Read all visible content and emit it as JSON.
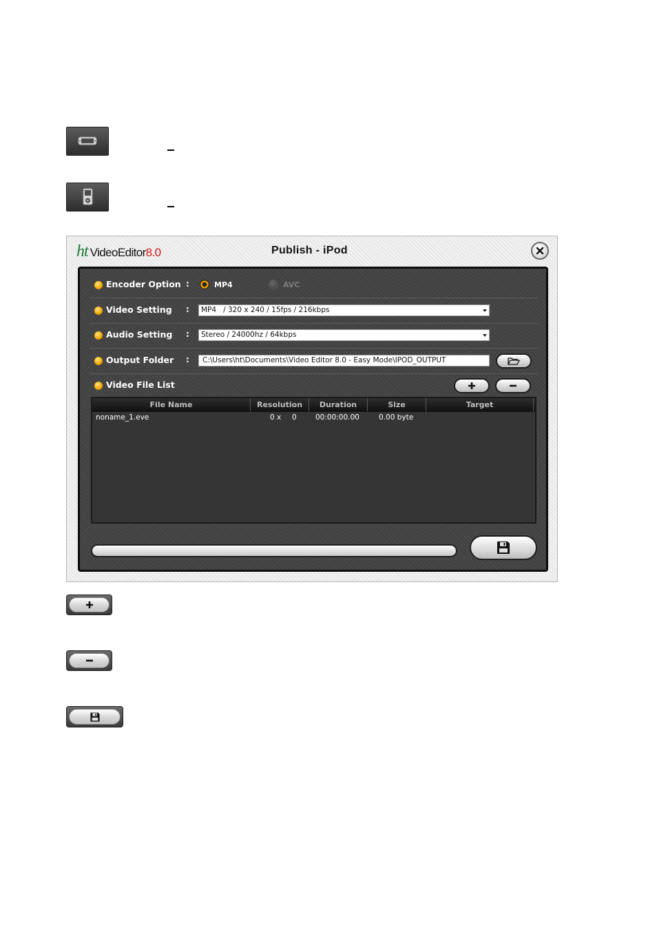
{
  "page_icons": [
    {
      "name": "psp-device-icon"
    },
    {
      "name": "ipod-device-icon"
    }
  ],
  "dialog": {
    "logo": {
      "ht": "ht",
      "name": "VideoEditor",
      "version": "8.0"
    },
    "title": "Publish - iPod",
    "encoder_option": {
      "label": "Encoder Option",
      "colon": ":",
      "options": [
        "MP4",
        "AVC"
      ],
      "selected": "MP4"
    },
    "video_setting": {
      "label": "Video Setting",
      "colon": ":",
      "value": "MP4   / 320 x 240 / 15fps / 216kbps"
    },
    "audio_setting": {
      "label": "Audio Setting",
      "colon": ":",
      "value": "Stereo / 24000hz / 64kbps"
    },
    "output_folder": {
      "label": "Output Folder",
      "colon": ":",
      "value": "C:\\Users\\ht\\Documents\\Video Editor 8.0 - Easy Mode\\IPOD_OUTPUT"
    },
    "video_file_list": {
      "label": "Video File List",
      "columns": [
        "File Name",
        "Resolution",
        "Duration",
        "Size",
        "Target"
      ],
      "rows": [
        {
          "file_name": "noname_1.eve",
          "res_w": "0",
          "res_x": "x",
          "res_h": "0",
          "duration": "00:00:00.00",
          "size": "0.00 byte",
          "target": ""
        }
      ]
    },
    "progress": 0
  },
  "colors": {
    "accent": "#f0a400",
    "panel": "#444444",
    "logo_green": "#1f7a3a",
    "logo_red": "#d01414"
  }
}
